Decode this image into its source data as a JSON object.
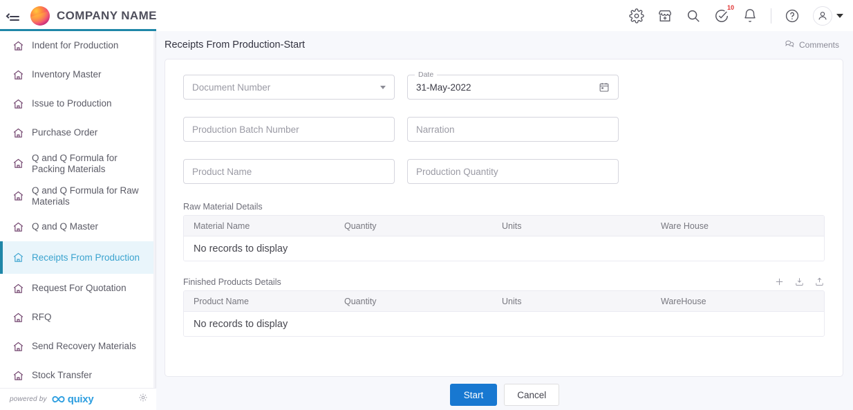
{
  "topbar": {
    "menu_icon": "collapse-menu-icon",
    "brand": "COMPANY NAME",
    "icons": [
      {
        "name": "settings-icon",
        "label": "Settings"
      },
      {
        "name": "marketplace-icon",
        "label": "Marketplace"
      },
      {
        "name": "search-icon",
        "label": "Search"
      },
      {
        "name": "tasks-icon",
        "label": "Tasks",
        "badge": "10"
      },
      {
        "name": "notifications-bell-icon",
        "label": "Notifications"
      },
      {
        "name": "help-icon",
        "label": "Help"
      }
    ],
    "badge_color": "#e03131"
  },
  "sidebar": {
    "accent_color": "#1f87a8",
    "active_bg": "#e9f5fb",
    "items": [
      {
        "label": "Indent for Production",
        "active": false
      },
      {
        "label": "Inventory Master",
        "active": false
      },
      {
        "label": "Issue to Production",
        "active": false
      },
      {
        "label": "Purchase Order",
        "active": false
      },
      {
        "label": "Q and Q Formula for Packing Materials",
        "active": false
      },
      {
        "label": "Q and Q Formula for Raw Materials",
        "active": false
      },
      {
        "label": "Q and Q Master",
        "active": false
      },
      {
        "label": "Receipts From Production",
        "active": true
      },
      {
        "label": "Request For Quotation",
        "active": false
      },
      {
        "label": "RFQ",
        "active": false
      },
      {
        "label": "Send Recovery Materials",
        "active": false
      },
      {
        "label": "Stock Transfer",
        "active": false
      }
    ],
    "footer": {
      "powered_by": "powered by",
      "product": "quixy",
      "gear_icon": "gear-icon"
    }
  },
  "main": {
    "page_title": "Receipts From Production-Start",
    "comments": {
      "label": "Comments",
      "icon": "comments-icon"
    },
    "fields": {
      "document_number": {
        "placeholder": "Document Number",
        "value": "",
        "type": "select"
      },
      "date": {
        "label": "Date",
        "value": "31-May-2022",
        "icon": "calendar-icon"
      },
      "production_batch_number": {
        "placeholder": "Production Batch Number",
        "value": ""
      },
      "narration": {
        "placeholder": "Narration",
        "value": ""
      },
      "product_name": {
        "placeholder": "Product Name",
        "value": ""
      },
      "production_quantity": {
        "placeholder": "Production Quantity",
        "value": ""
      }
    },
    "tables": [
      {
        "title": "Raw Material Details",
        "columns": [
          "Material Name",
          "Quantity",
          "Units",
          "Ware House"
        ],
        "rows": [],
        "empty_text": "No records to display",
        "actions": []
      },
      {
        "title": "Finished Products Details",
        "columns": [
          "Product Name",
          "Quantity",
          "Units",
          "WareHouse"
        ],
        "rows": [],
        "empty_text": "No records to display",
        "actions": [
          {
            "name": "add-row-icon",
            "label": "Add"
          },
          {
            "name": "download-icon",
            "label": "Download"
          },
          {
            "name": "upload-icon",
            "label": "Upload"
          }
        ]
      }
    ],
    "buttons": {
      "start": "Start",
      "cancel": "Cancel",
      "start_color": "#1878d1"
    }
  }
}
